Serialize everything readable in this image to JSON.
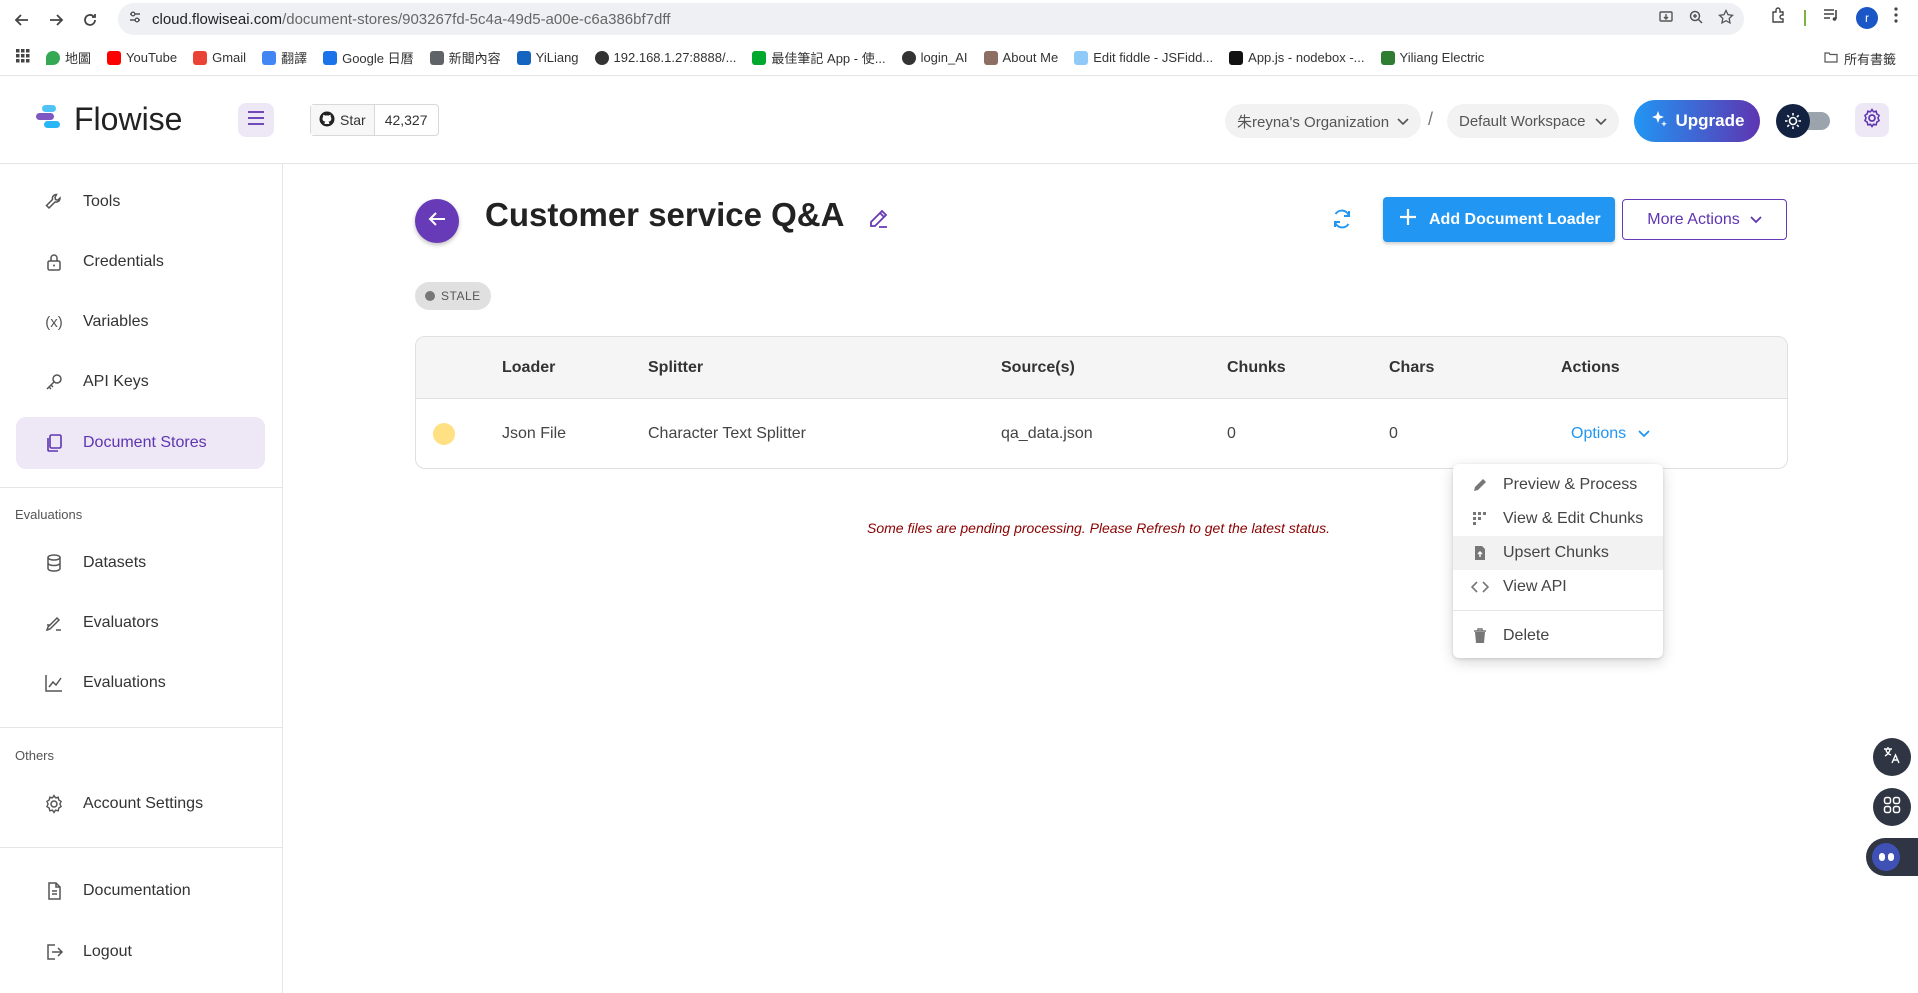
{
  "browser": {
    "url_host": "cloud.flowiseai.com",
    "url_path": "/document-stores/903267fd-5c4a-49d5-a00e-c6a386bf7dff",
    "bookmarks": [
      "地圖",
      "YouTube",
      "Gmail",
      "翻譯",
      "Google 日曆",
      "新聞內容",
      "YiLiang",
      "192.168.1.27:8888/...",
      "最佳筆記 App - 使...",
      "login_AI",
      "About Me",
      "Edit fiddle - JSFidd...",
      "App.js - nodebox -...",
      "Yiliang Electric"
    ],
    "bookmarks_all": "所有書籤",
    "profile_initial": "r"
  },
  "header": {
    "logo": "Flowise",
    "github_star": "Star",
    "github_count": "42,327",
    "organization": "朱reyna's Organization",
    "separator": "/",
    "workspace": "Default Workspace",
    "upgrade": "Upgrade"
  },
  "sidebar": {
    "items_top": [
      {
        "label": "Tools",
        "icon": "tool-icon"
      },
      {
        "label": "Credentials",
        "icon": "lock-icon"
      },
      {
        "label": "Variables",
        "icon": "variable-icon"
      },
      {
        "label": "API Keys",
        "icon": "key-icon"
      },
      {
        "label": "Document Stores",
        "icon": "files-icon",
        "active": true
      }
    ],
    "section_evaluations": "Evaluations",
    "items_eval": [
      {
        "label": "Datasets",
        "icon": "database-icon"
      },
      {
        "label": "Evaluators",
        "icon": "evaluator-icon"
      },
      {
        "label": "Evaluations",
        "icon": "chart-icon"
      }
    ],
    "section_others": "Others",
    "items_others": [
      {
        "label": "Account Settings",
        "icon": "gear-icon"
      }
    ],
    "items_bottom": [
      {
        "label": "Documentation",
        "icon": "document-icon"
      },
      {
        "label": "Logout",
        "icon": "logout-icon"
      }
    ]
  },
  "main": {
    "title": "Customer service Q&A",
    "add_loader": "Add Document Loader",
    "more_actions": "More Actions",
    "status_badge": "STALE",
    "table": {
      "headers": [
        "Loader",
        "Splitter",
        "Source(s)",
        "Chunks",
        "Chars",
        "Actions"
      ],
      "rows": [
        {
          "loader": "Json File",
          "splitter": "Character Text Splitter",
          "source": "qa_data.json",
          "chunks": "0",
          "chars": "0",
          "action": "Options"
        }
      ]
    },
    "pending_message": "Some files are pending processing. Please Refresh to get the latest status."
  },
  "dropdown": {
    "items": [
      {
        "label": "Preview & Process",
        "icon": "pencil-icon"
      },
      {
        "label": "View & Edit Chunks",
        "icon": "chunks-icon"
      },
      {
        "label": "Upsert Chunks",
        "icon": "upsert-icon"
      },
      {
        "label": "View API",
        "icon": "code-icon"
      },
      {
        "label": "Delete",
        "icon": "trash-icon"
      }
    ]
  },
  "colors": {
    "primary_purple": "#673ab7",
    "primary_blue": "#2196f3",
    "pending_dot": "#ffe082",
    "pending_text": "#8b0000"
  }
}
